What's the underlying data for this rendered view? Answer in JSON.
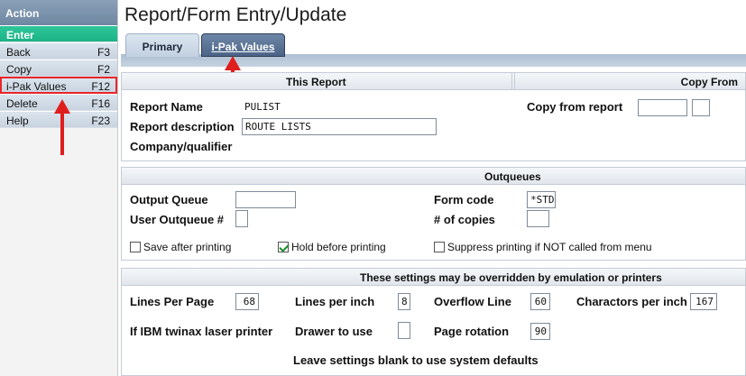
{
  "sidebar": {
    "header": "Action",
    "items": [
      {
        "label": "Enter",
        "key": ""
      },
      {
        "label": "Back",
        "key": "F3"
      },
      {
        "label": "Copy",
        "key": "F2"
      },
      {
        "label": "i-Pak Values",
        "key": "F12"
      },
      {
        "label": "Delete",
        "key": "F16"
      },
      {
        "label": "Help",
        "key": "F23"
      }
    ]
  },
  "title": "Report/Form Entry/Update",
  "tabs": [
    {
      "label": "Primary"
    },
    {
      "label": "i-Pak Values"
    }
  ],
  "this_report": {
    "heading": "This Report",
    "copy_heading": "Copy From",
    "report_name_label": "Report Name",
    "report_name_value": "PULIST",
    "report_desc_label": "Report description",
    "report_desc_value": "ROUTE LISTS",
    "company_label": "Company/qualifier",
    "copy_from_label": "Copy from report",
    "copy_from_value": "",
    "copy_from_value2": ""
  },
  "outqueues": {
    "heading": "Outqueues",
    "output_queue_label": "Output Queue",
    "output_queue_value": "",
    "user_outq_label": "User Outqueue #",
    "user_outq_value": "",
    "form_code_label": "Form code",
    "form_code_value": "*STD",
    "copies_label": "# of copies",
    "copies_value": "",
    "save_after": {
      "label": "Save after printing",
      "checked": false
    },
    "hold_before": {
      "label": "Hold before printing",
      "checked": true
    },
    "suppress": {
      "label": "Suppress printing if NOT called from menu",
      "checked": false
    }
  },
  "settings": {
    "heading": "These settings may be overridden by emulation or printers",
    "lines_per_page_label": "Lines Per Page",
    "lines_per_page_value": "68",
    "lines_per_inch_label": "Lines per inch",
    "lines_per_inch_value": "8",
    "overflow_label": "Overflow Line",
    "overflow_value": "60",
    "cpi_label": "Charactors per inch",
    "cpi_value": "167",
    "ibm_label": "If IBM twinax laser printer",
    "drawer_label": "Drawer to use",
    "drawer_value": "",
    "rotation_label": "Page rotation",
    "rotation_value": "90",
    "footer": "Leave settings blank to use system defaults"
  },
  "colors": {
    "accent_red": "#e01e1e",
    "enter_green": "#1bb286",
    "active_tab": "#4c6488"
  }
}
